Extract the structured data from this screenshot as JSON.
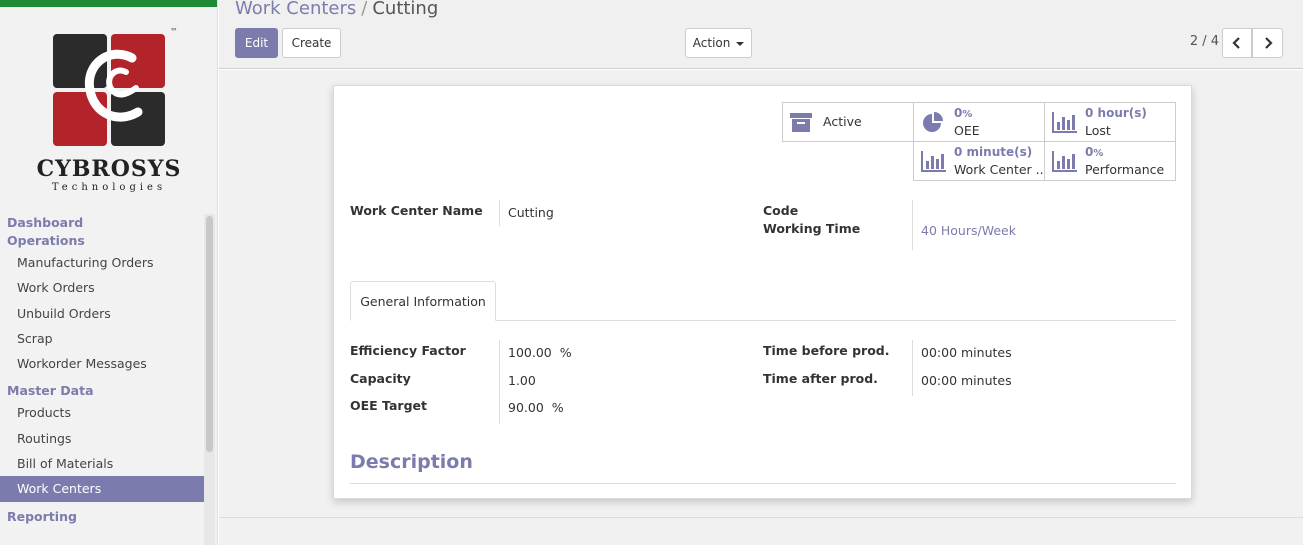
{
  "brand": {
    "name": "CYBROSYS",
    "subtitle": "Technologies",
    "tm": "™"
  },
  "sidebar": {
    "sections": [
      {
        "title": "Dashboard",
        "items": []
      },
      {
        "title": "Operations",
        "items": [
          "Manufacturing Orders",
          "Work Orders",
          "Unbuild Orders",
          "Scrap",
          "Workorder Messages"
        ]
      },
      {
        "title": "Master Data",
        "items": [
          "Products",
          "Routings",
          "Bill of Materials",
          "Work Centers"
        ]
      },
      {
        "title": "Reporting",
        "items": []
      }
    ],
    "active_item": "Work Centers"
  },
  "breadcrumb": {
    "parent": "Work Centers",
    "separator": "/",
    "current": "Cutting"
  },
  "toolbar": {
    "edit_label": "Edit",
    "create_label": "Create",
    "action_label": "Action"
  },
  "pager": {
    "text": "2 / 4",
    "prev_icon": "chevron-left-icon",
    "next_icon": "chevron-right-icon"
  },
  "stat_buttons": {
    "active": {
      "label": "Active",
      "icon": "archive-icon"
    },
    "oee": {
      "value": "0",
      "unit": "%",
      "label": "OEE",
      "icon": "pie-chart-icon"
    },
    "lost": {
      "value": "0",
      "unit": "hour(s)",
      "label": "Lost",
      "icon": "bar-chart-icon"
    },
    "load": {
      "value": "0",
      "unit": "minute(s)",
      "label": "Work Center ...",
      "icon": "bar-chart-icon"
    },
    "performance": {
      "value": "0",
      "unit": "%",
      "label": "Performance",
      "icon": "bar-chart-icon"
    }
  },
  "fields": {
    "name_label": "Work Center Name",
    "name_value": "Cutting",
    "code_label": "Code",
    "code_value": "",
    "working_time_label": "Working Time",
    "working_time_value": "40 Hours/Week"
  },
  "tab": {
    "label": "General Information"
  },
  "general": {
    "efficiency_label": "Efficiency Factor",
    "efficiency_value": "100.00",
    "efficiency_unit": "%",
    "capacity_label": "Capacity",
    "capacity_value": "1.00",
    "oee_target_label": "OEE Target",
    "oee_target_value": "90.00",
    "oee_target_unit": "%",
    "time_before_label": "Time before prod.",
    "time_before_value": "00:00 minutes",
    "time_after_label": "Time after prod.",
    "time_after_value": "00:00 minutes"
  },
  "description": {
    "title": "Description"
  },
  "colors": {
    "accent": "#7c7bad",
    "topbar": "#1e8a35",
    "logo_red": "#b3242a",
    "logo_dark": "#2b2b2b"
  }
}
